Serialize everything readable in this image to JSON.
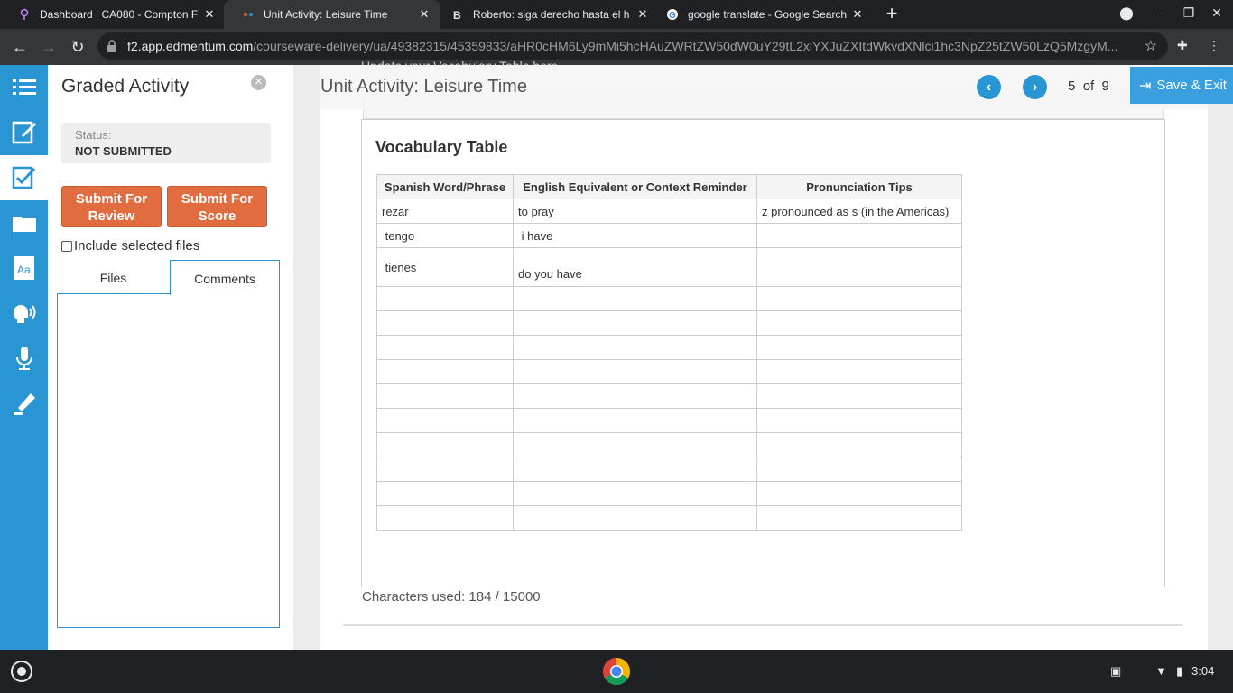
{
  "browser": {
    "tabs": [
      {
        "title": "Dashboard | CA080 - Compton F",
        "active": false
      },
      {
        "title": "Unit Activity: Leisure Time",
        "active": true
      },
      {
        "title": "Roberto: siga derecho hasta el h",
        "active": false
      },
      {
        "title": "google translate - Google Search",
        "active": false
      }
    ],
    "url_host": "f2.app.edmentum.com",
    "url_path": "/courseware-delivery/ua/49382315/45359833/aHR0cHM6Ly9mMi5hcHAuZWRtZW50dW0uY29tL2xlYXJuZXItdWkvdXNlci1hc3NpZ25tZW50LzQ5MzgyM..."
  },
  "panel": {
    "title": "Graded Activity",
    "status_label": "Status:",
    "status_value": "NOT SUBMITTED",
    "submit_review": "Submit For Review",
    "submit_score": "Submit For Score",
    "include_files": "Include selected files",
    "tab_files": "Files",
    "tab_comments": "Comments"
  },
  "header": {
    "ghost_text": "Update your Vocabulary Table here.",
    "unit_title": "Unit Activity: Leisure Time",
    "page_current": "5",
    "page_of": "of",
    "page_total": "9",
    "save_exit": "Save & Exit"
  },
  "editor": {
    "vocab_title": "Vocabulary Table",
    "columns": [
      "Spanish Word/Phrase",
      "English Equivalent or Context Reminder",
      "Pronunciation Tips"
    ],
    "rows": [
      [
        "rezar",
        "to pray",
        "z pronounced as s (in the Americas)"
      ],
      [
        " tengo",
        " i have",
        ""
      ],
      [
        " tienes",
        "do you have",
        ""
      ],
      [
        "",
        "",
        ""
      ],
      [
        "",
        "",
        ""
      ],
      [
        "",
        "",
        ""
      ],
      [
        "",
        "",
        ""
      ],
      [
        "",
        "",
        ""
      ],
      [
        "",
        "",
        ""
      ],
      [
        "",
        "",
        ""
      ],
      [
        "",
        "",
        ""
      ],
      [
        "",
        "",
        ""
      ],
      [
        "",
        "",
        ""
      ]
    ],
    "chars_used": "Characters used: 184 / 15000"
  },
  "taskbar": {
    "time": "3:04"
  },
  "colors": {
    "accent": "#2a95d3",
    "orange": "#e06c40"
  }
}
